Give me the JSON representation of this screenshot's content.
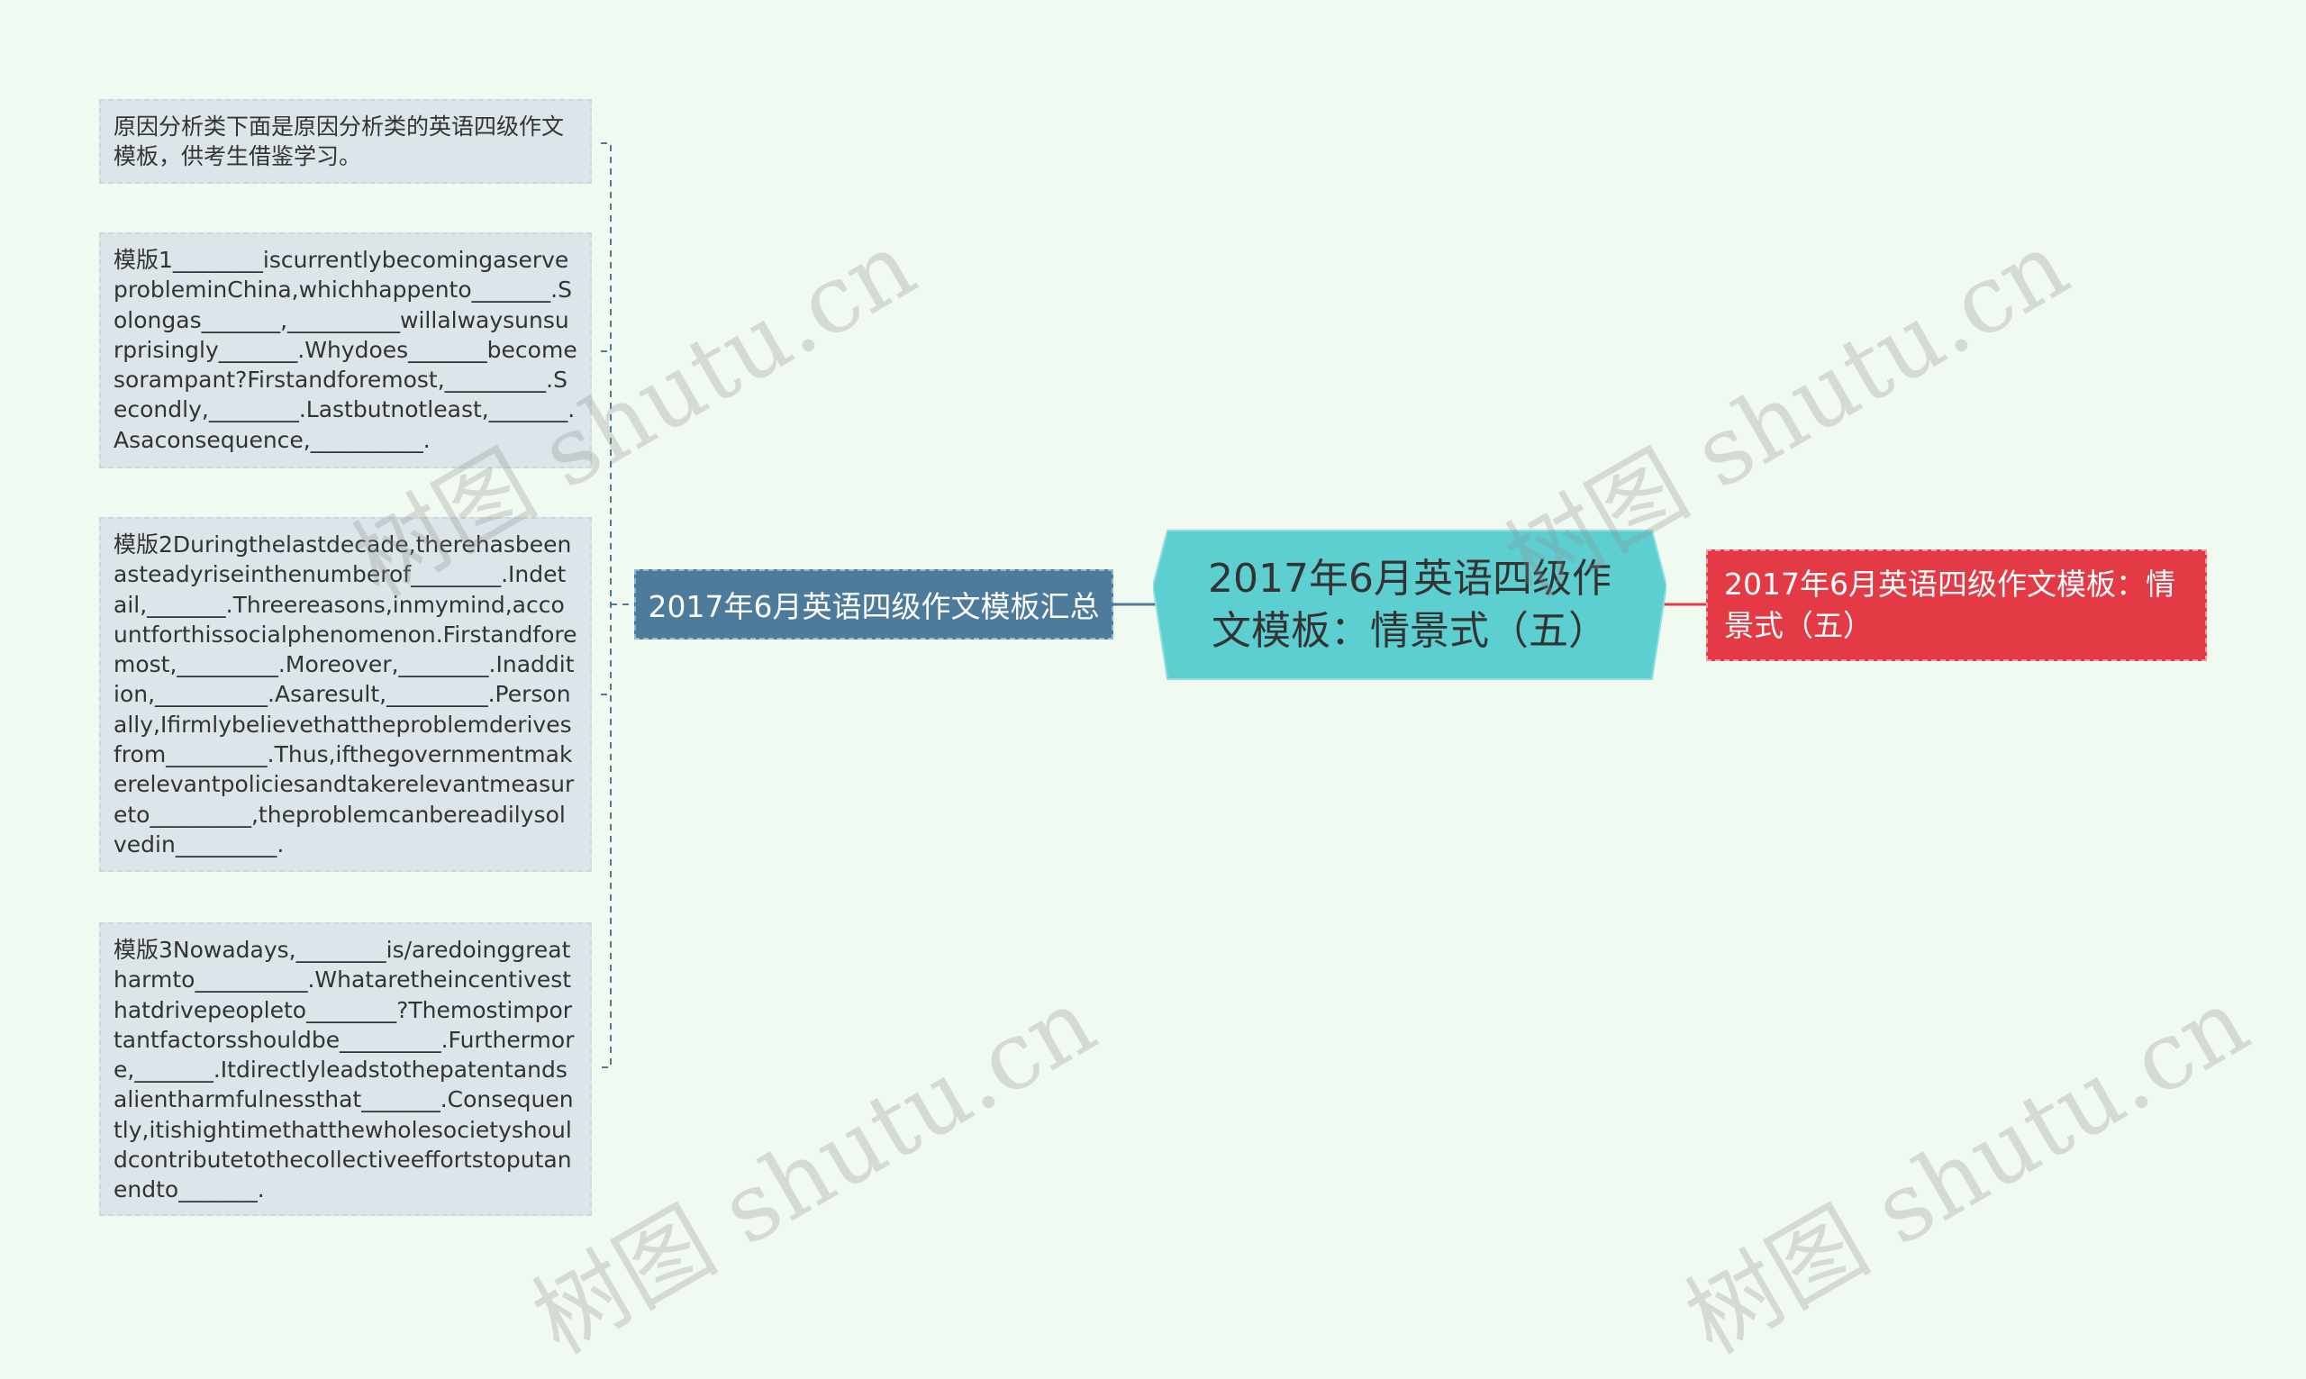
{
  "center_topic": {
    "text": "2017年6月英语四级作文模板：情景式（五）",
    "color": "#5ecfd1"
  },
  "left_branch": {
    "label": "2017年6月英语四级作文模板汇总",
    "color": "#4d7b9b"
  },
  "right_branch": {
    "label": "2017年6月英语四级作文模板：情景式（五）",
    "color": "#e43a46"
  },
  "leaves": [
    "原因分析类下面是原因分析类的英语四级作文模板，供考生借鉴学习。",
    "模版1________iscurrentlybecomingaserveprobleminChina,whichhappento_______.Solongas_______,__________willalwaysunsurprisingly_______.Whydoes_______becomesorampant?Firstandforemost,_________.Secondly,________.Lastbutnotleast,_______.Asaconsequence,__________.",
    "模版2Duringthelastdecade,therehasbeenasteadyriseinthenumberof________.Indetail,_______.Threereasons,inmymind,accountforthissocialphenomenon.Firstandforemost,_________.Moreover,________.Inaddition,__________.Asaresult,_________.Personally,Ifirmlybelievethattheproblemderivesfrom_________.Thus,ifthegovernmentmakerelevantpoliciesandtakerelevantmeasureto_________,theproblemcanbereadilysolvedin_________.",
    "模版3Nowadays,________is/aredoinggreatharmto__________.Whataretheincentivesthatdrivepeopleto________?Themostimportantfactorsshouldbe_________.Furthermore,_______.Itdirectlyleadstothepatentandsalientharmfulnessthat_______.Consequently,itishightimethatthewholesocietyshouldcontributetothecollectiveeffortstoputanendto_______."
  ],
  "watermarks": [
    "树图 shutu.cn",
    "树图 shutu.cn",
    "树图 shutu.cn",
    "树图 shutu.cn"
  ]
}
